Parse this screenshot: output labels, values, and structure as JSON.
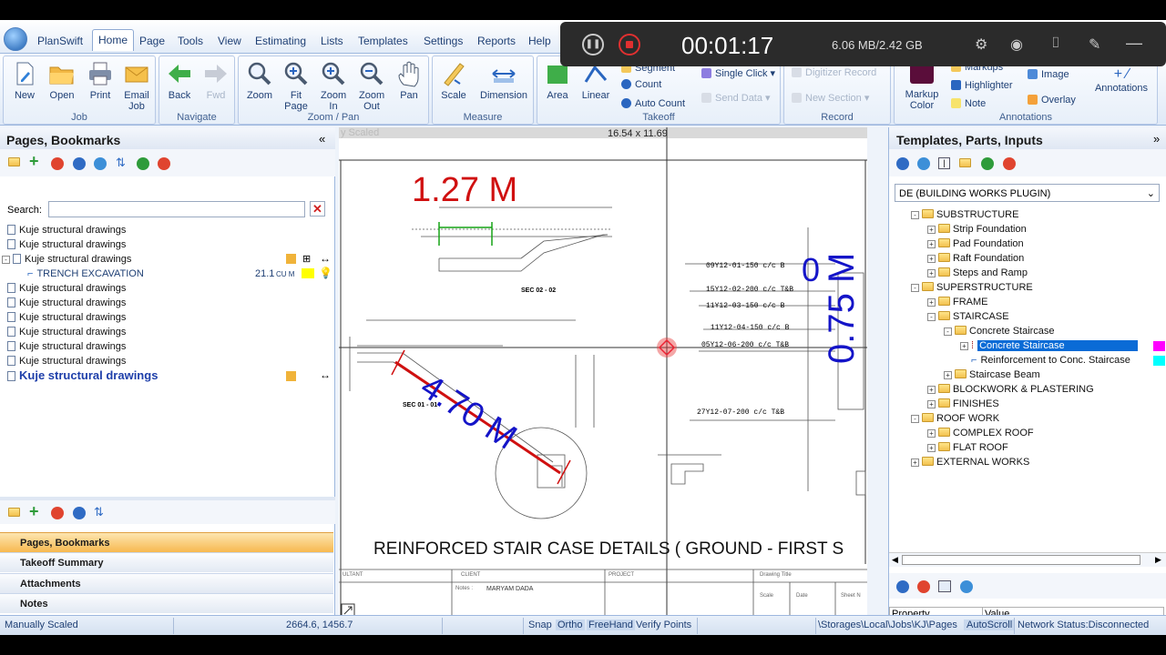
{
  "app": {
    "name": "PlanSwift"
  },
  "tabs": [
    "Home",
    "Page",
    "Tools",
    "View",
    "Estimating",
    "Lists",
    "Templates",
    "Settings",
    "Reports",
    "Help"
  ],
  "ribbon": {
    "job": {
      "label": "Job",
      "new": "New",
      "open": "Open",
      "print": "Print",
      "email": "Email Job"
    },
    "navigate": {
      "label": "Navigate",
      "back": "Back",
      "fwd": "Fwd"
    },
    "zoom": {
      "label": "Zoom / Pan",
      "zoom": "Zoom",
      "fit": "Fit Page",
      "zin": "Zoom In",
      "zout": "Zoom Out",
      "pan": "Pan"
    },
    "measure": {
      "label": "Measure",
      "scale": "Scale",
      "dimension": "Dimension"
    },
    "takeoff": {
      "label": "Takeoff",
      "area": "Area",
      "linear": "Linear",
      "segment": "Segment",
      "count": "Count",
      "auto_count": "Auto Count",
      "single_click": "Single Click",
      "send_data": "Send Data"
    },
    "record": {
      "label": "Record",
      "digitizer": "Digitizer Record",
      "new_section": "New Section"
    },
    "annotations": {
      "label": "Annotations",
      "markup": "Markups",
      "markup_color": "Markup Color",
      "highlighter": "Highlighter",
      "note": "Note",
      "image": "Image",
      "overlay": "Overlay",
      "annotations": "Annotations"
    }
  },
  "recorder": {
    "time": "00:01:17",
    "size": "6.06 MB/2.42 GB"
  },
  "left_panel": {
    "title": "Pages, Bookmarks",
    "search_label": "Search:",
    "items": [
      "Kuje structural drawings",
      "Kuje structural drawings",
      "Kuje structural drawings",
      "TRENCH EXCAVATION",
      "Kuje structural drawings",
      "Kuje structural drawings",
      "Kuje structural drawings",
      "Kuje structural drawings",
      "Kuje structural drawings",
      "Kuje structural drawings",
      "Kuje structural drawings"
    ],
    "trench_value": "21.1",
    "trench_unit": "CU M",
    "nav": [
      "Pages, Bookmarks",
      "Takeoff Summary",
      "Attachments",
      "Notes"
    ]
  },
  "canvas": {
    "top_label": "y Scaled",
    "sheet_size": "16.54 x 11.69",
    "meas_1": "1.27 M",
    "meas_2": "4.70 M",
    "meas_3": "0.75 M",
    "meas_4": "0",
    "sec_02": "SEC 02 - 02",
    "sec_01": "SEC 01 - 01",
    "title": "REINFORCED STAIR CASE DETAILS ( GROUND - FIRST S",
    "rebar": [
      "09Y12-01-150 c/c B",
      "15Y12-02-200 c/c T&B",
      "11Y12-03-150 c/c B",
      "11Y12-04-150 c/c B",
      "05Y12-06-200 c/c T&B",
      "27Y12-07-200 c/c T&B"
    ],
    "client": "CLIENT",
    "project": "PROJECT",
    "consultant": "ULTANT",
    "drawing_title": "Drawing Title",
    "client_name": "MARYAM DADA",
    "notes": "Notes :",
    "scale": "Scale",
    "date": "Date",
    "sheet": "Sheet N"
  },
  "right_panel": {
    "title": "Templates, Parts, Inputs",
    "dropdown": "DE (BUILDING WORKS PLUGIN)",
    "tree": [
      {
        "label": "SUBSTRUCTURE",
        "lvl": 0,
        "pm": "-"
      },
      {
        "label": "Strip Foundation",
        "lvl": 1,
        "pm": "+"
      },
      {
        "label": "Pad Foundation",
        "lvl": 1,
        "pm": "+"
      },
      {
        "label": "Raft Foundation",
        "lvl": 1,
        "pm": "+"
      },
      {
        "label": "Steps and Ramp",
        "lvl": 1,
        "pm": "+"
      },
      {
        "label": "SUPERSTRUCTURE",
        "lvl": 0,
        "pm": "-"
      },
      {
        "label": "FRAME",
        "lvl": 1,
        "pm": "+"
      },
      {
        "label": "STAIRCASE",
        "lvl": 1,
        "pm": "-"
      },
      {
        "label": "Concrete Staircase",
        "lvl": 2,
        "pm": "-"
      },
      {
        "label": "Concrete Staircase",
        "lvl": 3,
        "pm": "+",
        "sel": true
      },
      {
        "label": "Reinforcement to Conc. Staircase",
        "lvl": 3,
        "pm": ""
      },
      {
        "label": "Staircase Beam",
        "lvl": 2,
        "pm": "+"
      },
      {
        "label": "BLOCKWORK & PLASTERING",
        "lvl": 1,
        "pm": "+"
      },
      {
        "label": "FINISHES",
        "lvl": 1,
        "pm": "+"
      },
      {
        "label": "ROOF WORK",
        "lvl": 0,
        "pm": "-"
      },
      {
        "label": "COMPLEX ROOF",
        "lvl": 1,
        "pm": "+"
      },
      {
        "label": "FLAT ROOF",
        "lvl": 1,
        "pm": "+"
      },
      {
        "label": "EXTERNAL WORKS",
        "lvl": 0,
        "pm": "+"
      }
    ],
    "prop_header": "Property",
    "value_header": "Value"
  },
  "status": {
    "scaled": "Manually Scaled",
    "coords": "2664.6, 1456.7",
    "snap": "Snap",
    "ortho": "Ortho",
    "freehand": "FreeHand",
    "verify": "Verify Points",
    "path": "\\Storages\\Local\\Jobs\\KJ\\Pages\\Ki",
    "autoscroll": "AutoScroll",
    "network": "Network Status:Disconnected"
  },
  "colors": {
    "accent": "#1e3f74",
    "selection": "#0a6bd6",
    "measure_blue": "#1414c8",
    "measure_red": "#d01010",
    "swatch_magenta": "#ff00ff",
    "swatch_cyan": "#00ffff"
  }
}
